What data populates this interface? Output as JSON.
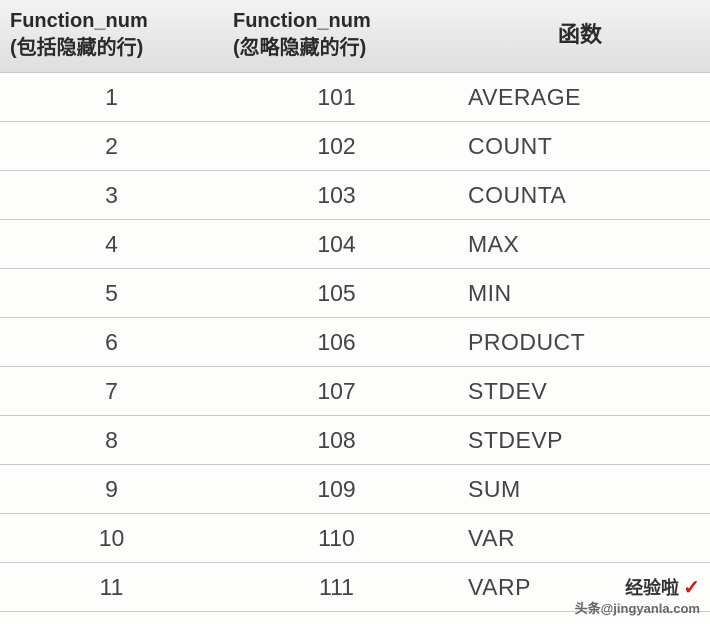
{
  "headers": {
    "col1_line1": "Function_num",
    "col1_line2": "(包括隐藏的行)",
    "col2_line1": "Function_num",
    "col2_line2": "(忽略隐藏的行)",
    "col3": "函数"
  },
  "rows": [
    {
      "a": "1",
      "b": "101",
      "c": "AVERAGE"
    },
    {
      "a": "2",
      "b": "102",
      "c": "COUNT"
    },
    {
      "a": "3",
      "b": "103",
      "c": "COUNTA"
    },
    {
      "a": "4",
      "b": "104",
      "c": "MAX"
    },
    {
      "a": "5",
      "b": "105",
      "c": "MIN"
    },
    {
      "a": "6",
      "b": "106",
      "c": "PRODUCT"
    },
    {
      "a": "7",
      "b": "107",
      "c": "STDEV"
    },
    {
      "a": "8",
      "b": "108",
      "c": "STDEVP"
    },
    {
      "a": "9",
      "b": "109",
      "c": "SUM"
    },
    {
      "a": "10",
      "b": "110",
      "c": "VAR"
    },
    {
      "a": "11",
      "b": "111",
      "c": "VARP"
    }
  ],
  "watermark": {
    "line1": "经验啦",
    "check": "✓",
    "line2": "头条@jingyanla.com"
  }
}
